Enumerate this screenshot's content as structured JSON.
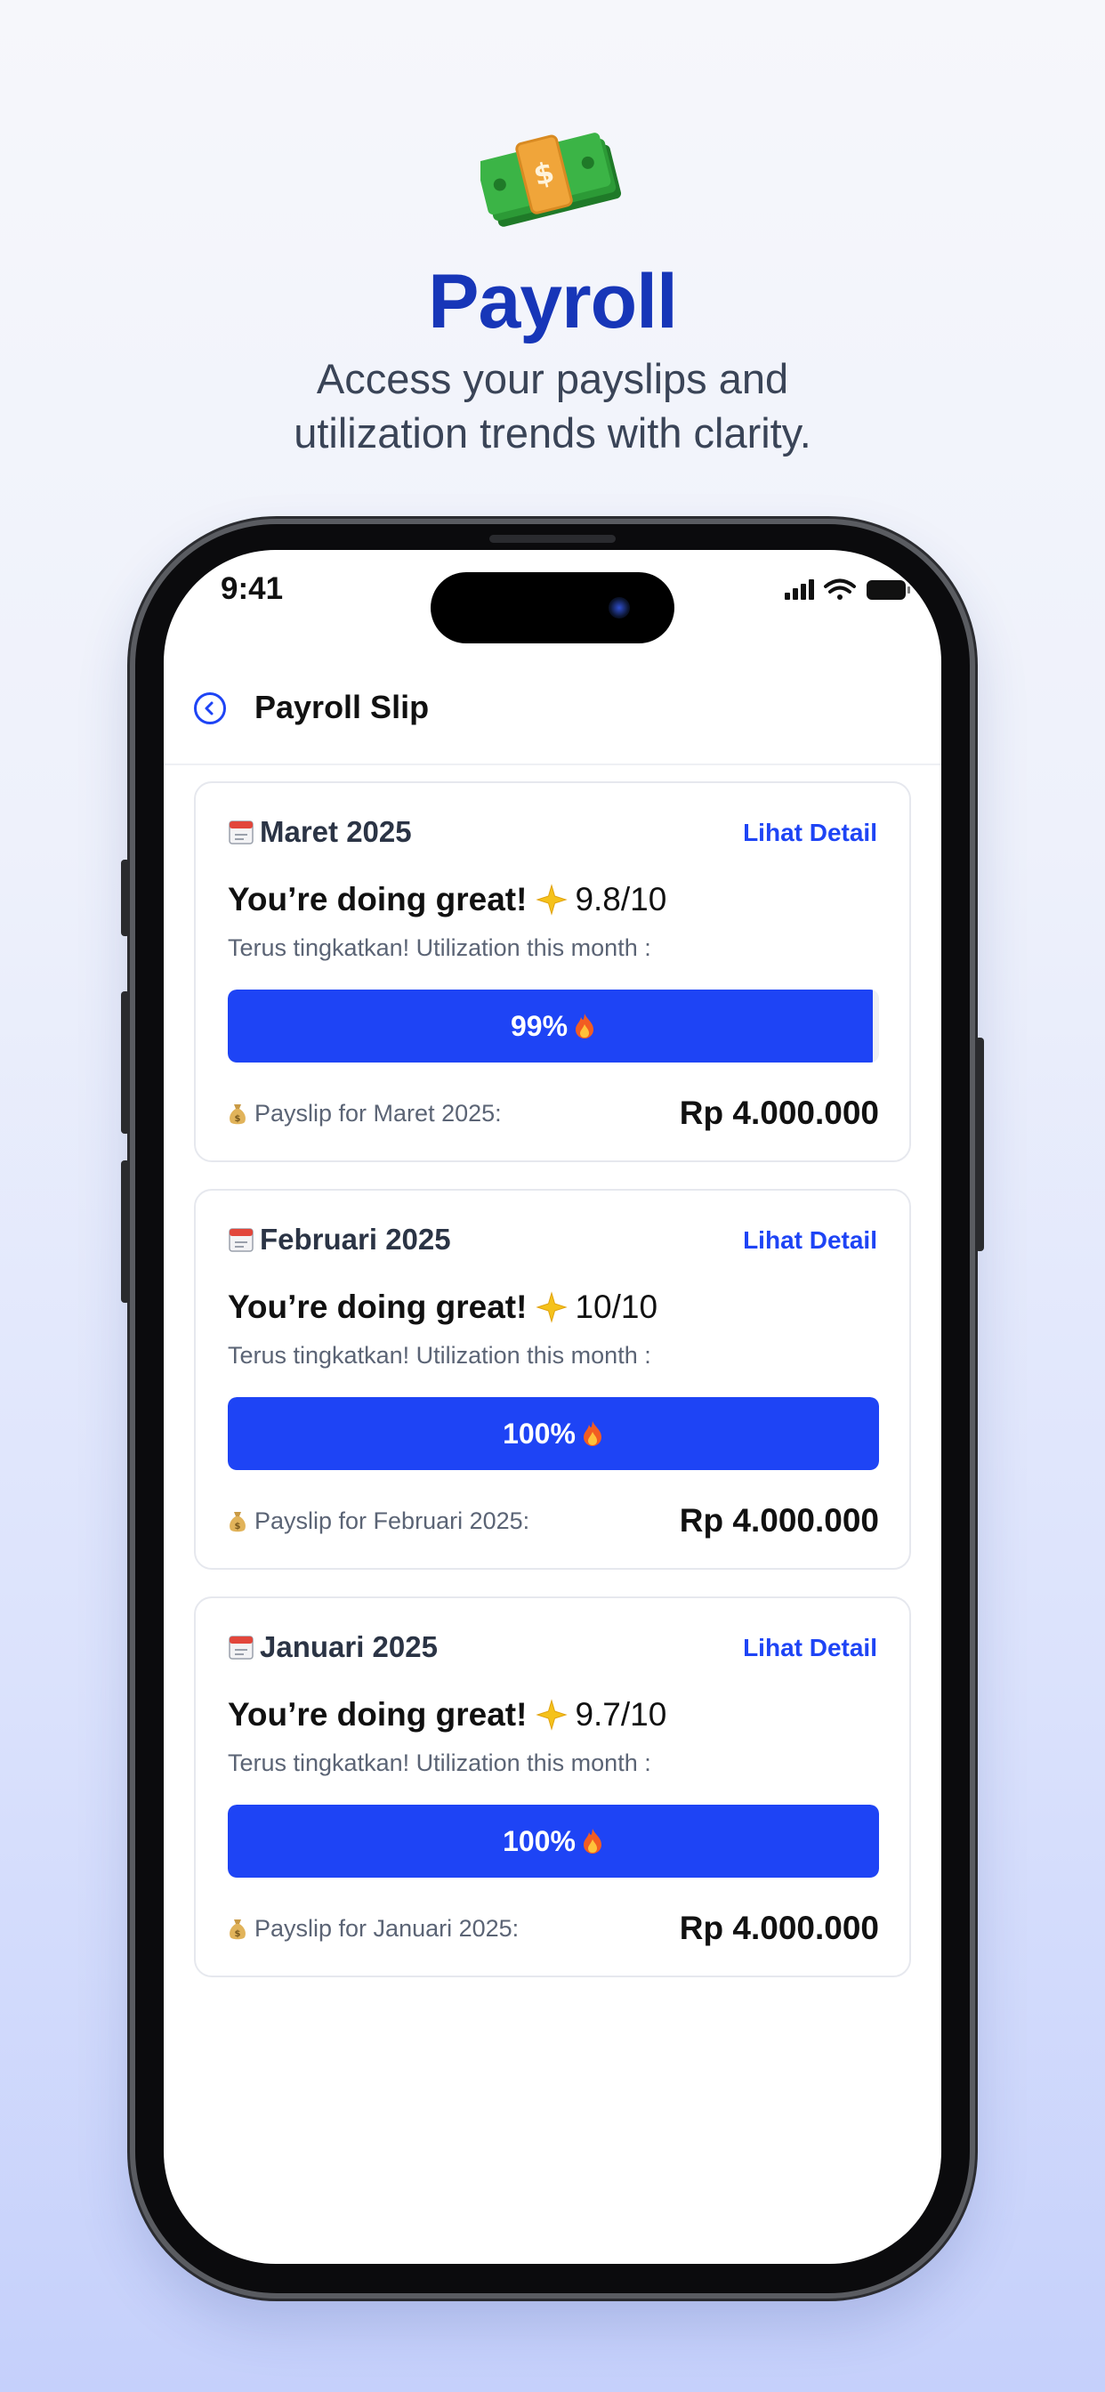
{
  "hero": {
    "title": "Payroll",
    "subtitle": "Access your payslips and utilization trends with clarity.",
    "icon": "money-stack-icon"
  },
  "status_bar": {
    "time": "9:41"
  },
  "appbar": {
    "title": "Payroll Slip"
  },
  "cards": [
    {
      "month": "Maret 2025",
      "detail_label": "Lihat Detail",
      "score_label": "You’re doing great!",
      "score": "9.8/10",
      "hint": "Terus tingkatkan! Utilization this month :",
      "utilization_label": "99%",
      "utilization": 0.99,
      "payslip_label": "Payslip for Maret 2025:",
      "amount": "Rp 4.000.000"
    },
    {
      "month": "Februari 2025",
      "detail_label": "Lihat Detail",
      "score_label": "You’re doing great!",
      "score": "10/10",
      "hint": "Terus tingkatkan! Utilization this month :",
      "utilization_label": "100%",
      "utilization": 1.0,
      "payslip_label": "Payslip for Februari 2025:",
      "amount": "Rp 4.000.000"
    },
    {
      "month": "Januari 2025",
      "detail_label": "Lihat Detail",
      "score_label": "You’re doing great!",
      "score": "9.7/10",
      "hint": "Terus tingkatkan! Utilization this month :",
      "utilization_label": "100%",
      "utilization": 1.0,
      "payslip_label": "Payslip for Januari 2025:",
      "amount": "Rp 4.000.000"
    }
  ],
  "colors": {
    "accent": "#1e44f5",
    "title": "#1736b8"
  }
}
